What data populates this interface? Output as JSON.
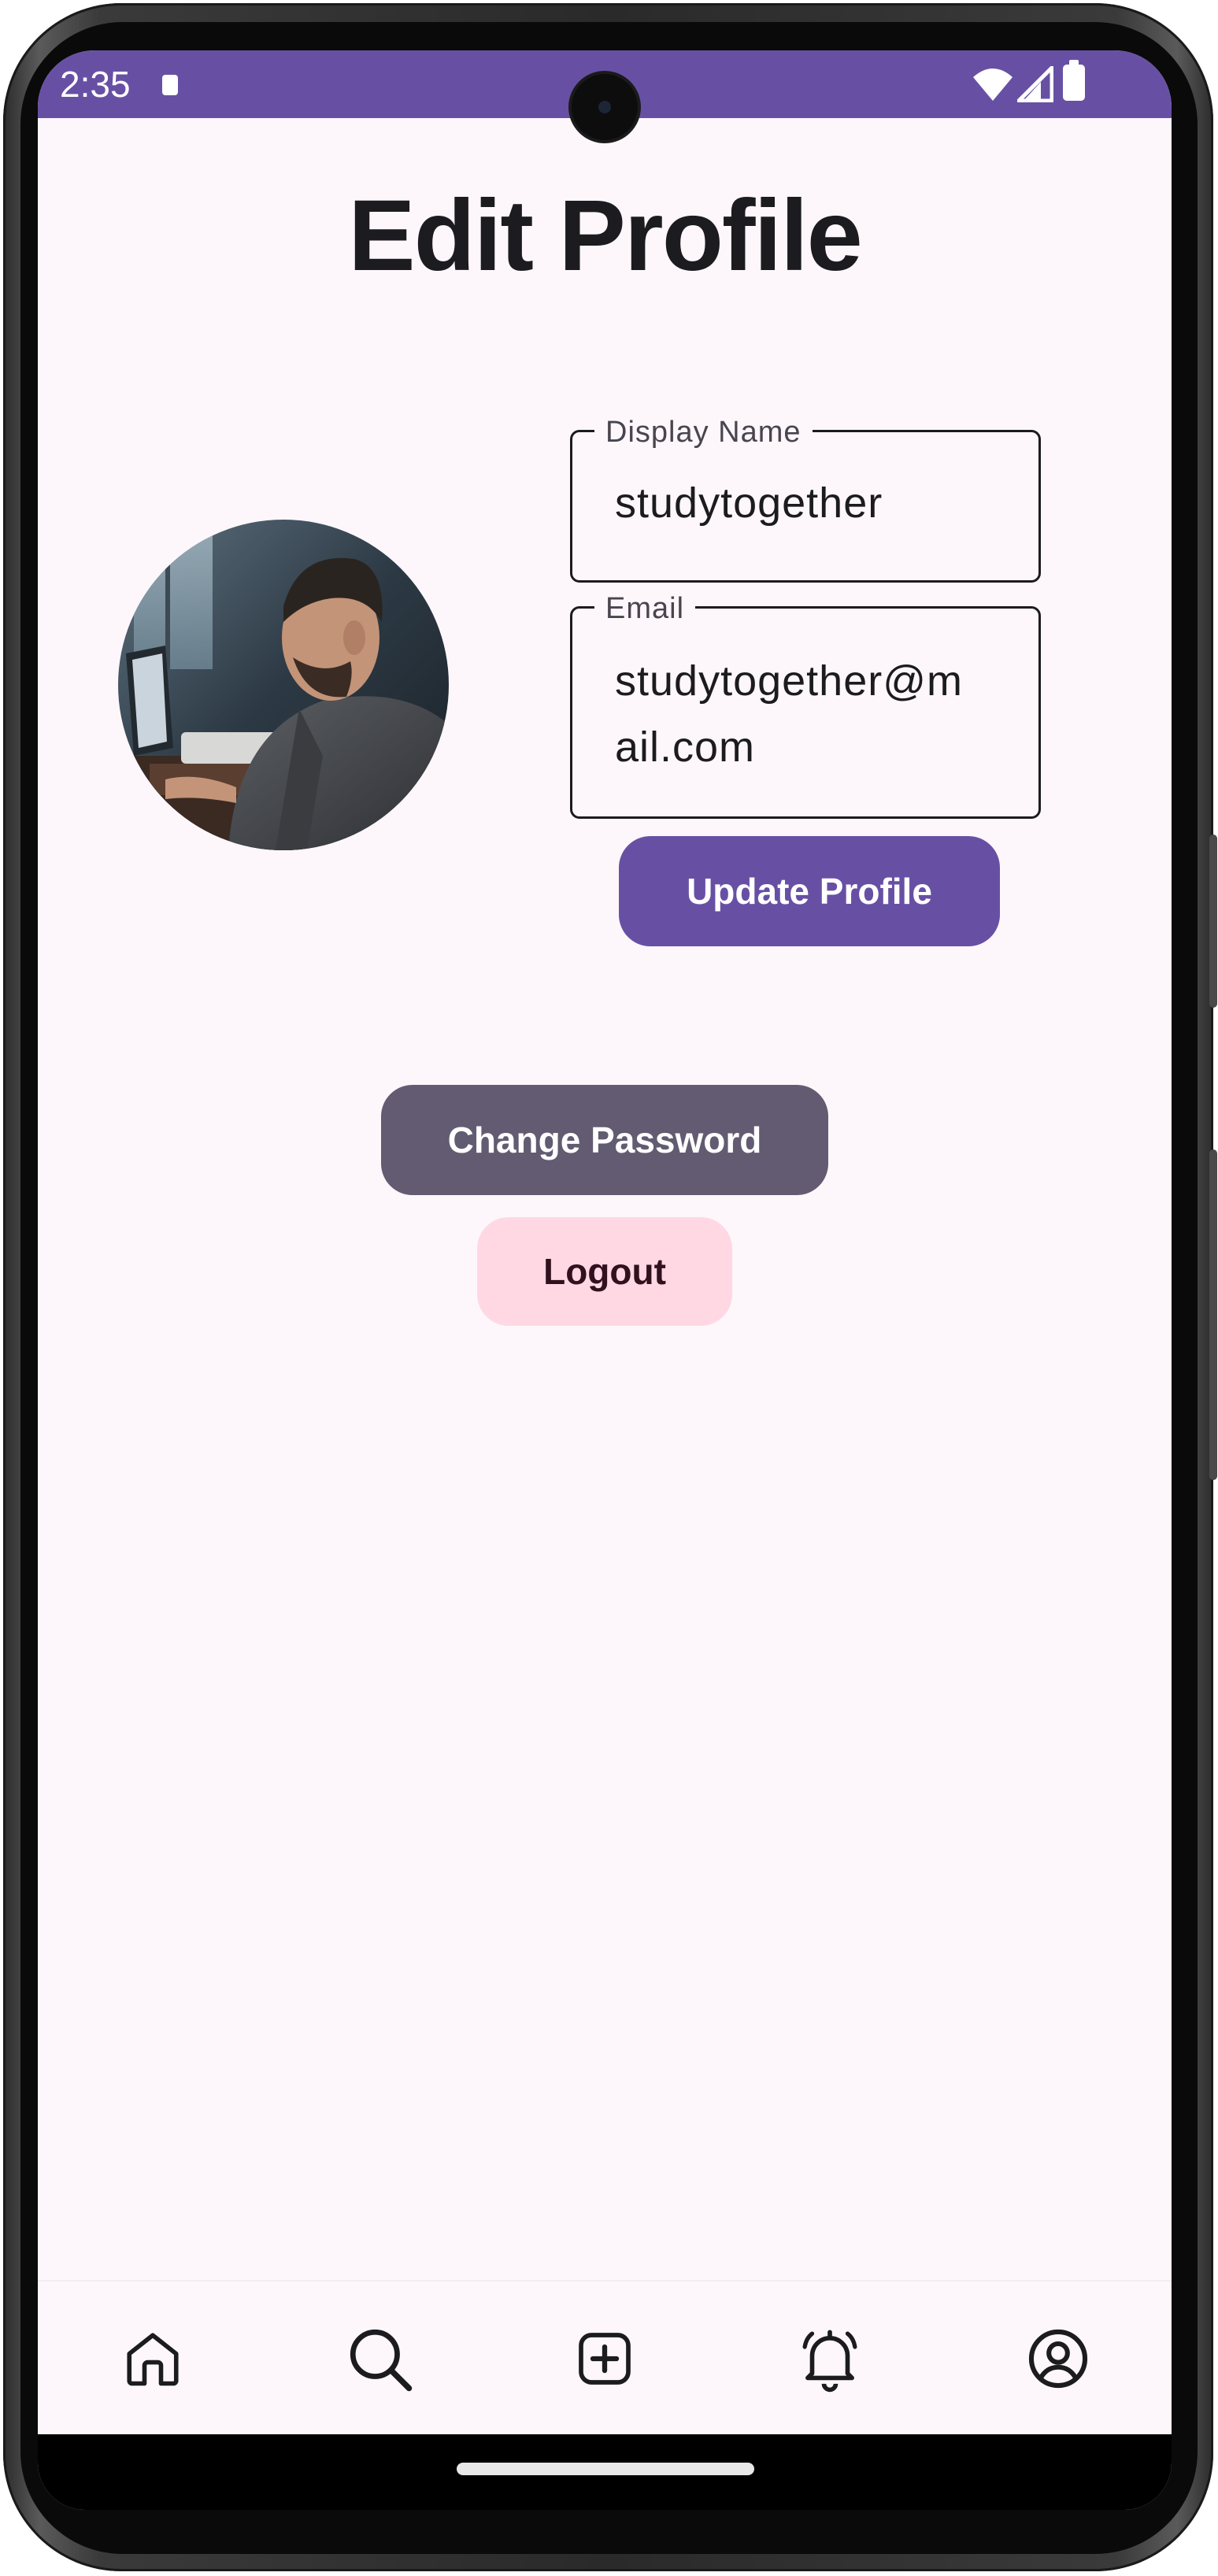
{
  "status_bar": {
    "time": "2:35",
    "background": "#6750a4",
    "icons": [
      "notification-icon",
      "wifi-icon",
      "signal-icon",
      "battery-icon"
    ]
  },
  "page": {
    "title": "Edit Profile"
  },
  "profile": {
    "avatar_icon": "profile-photo"
  },
  "form": {
    "display_name": {
      "label": "Display Name",
      "value": "studytogether"
    },
    "email": {
      "label": "Email",
      "value_line1": "studytogether@m",
      "value_line2": "ail.com"
    },
    "update_button": "Update Profile"
  },
  "actions": {
    "change_password": "Change Password",
    "logout": "Logout"
  },
  "bottom_nav": {
    "items": [
      {
        "icon": "home-icon"
      },
      {
        "icon": "search-icon"
      },
      {
        "icon": "add-post-icon"
      },
      {
        "icon": "notifications-bell-icon"
      },
      {
        "icon": "account-circle-icon"
      }
    ]
  },
  "colors": {
    "primary": "#6750a4",
    "secondary": "#625b71",
    "tertiary_container": "#ffd8e4",
    "background": "#fdf7fb"
  }
}
